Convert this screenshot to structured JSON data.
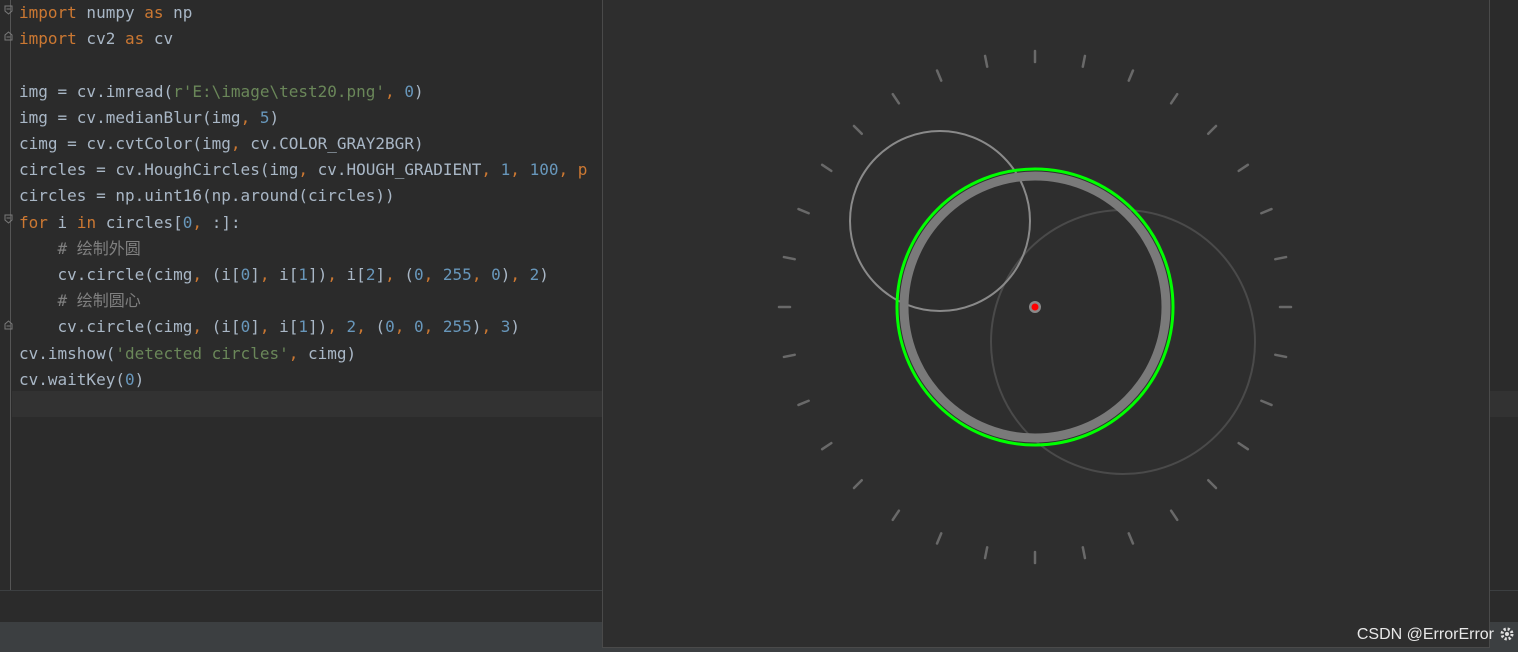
{
  "editor": {
    "lines": [
      {
        "tokens": [
          {
            "t": "import",
            "c": "kw"
          },
          {
            "t": " numpy "
          },
          {
            "t": "as",
            "c": "kw"
          },
          {
            "t": " np"
          }
        ]
      },
      {
        "tokens": [
          {
            "t": "import",
            "c": "kw"
          },
          {
            "t": " cv2 "
          },
          {
            "t": "as",
            "c": "kw"
          },
          {
            "t": " cv"
          }
        ]
      },
      {
        "tokens": []
      },
      {
        "tokens": [
          {
            "t": "img = cv.imread("
          },
          {
            "t": "r'E:\\image\\test20.png'",
            "c": "str"
          },
          {
            "t": ", ",
            "c": "kw"
          },
          {
            "t": "0",
            "c": "num"
          },
          {
            "t": ")"
          }
        ]
      },
      {
        "tokens": [
          {
            "t": "img = cv.medianBlur(img"
          },
          {
            "t": ", ",
            "c": "kw"
          },
          {
            "t": "5",
            "c": "num"
          },
          {
            "t": ")"
          }
        ]
      },
      {
        "tokens": [
          {
            "t": "cimg = cv.cvtColor(img"
          },
          {
            "t": ", ",
            "c": "kw"
          },
          {
            "t": "cv.COLOR_GRAY2BGR)"
          }
        ]
      },
      {
        "tokens": [
          {
            "t": "circles = cv.HoughCircles(img"
          },
          {
            "t": ", ",
            "c": "kw"
          },
          {
            "t": "cv.HOUGH_GRADIENT"
          },
          {
            "t": ", ",
            "c": "kw"
          },
          {
            "t": "1",
            "c": "num"
          },
          {
            "t": ", ",
            "c": "kw"
          },
          {
            "t": "100",
            "c": "num"
          },
          {
            "t": ", p",
            "c": "kw"
          }
        ]
      },
      {
        "tokens": [
          {
            "t": "circles = np.uint16(np.around(circles))"
          }
        ]
      },
      {
        "tokens": [
          {
            "t": "for",
            "c": "kw"
          },
          {
            "t": " i "
          },
          {
            "t": "in",
            "c": "kw"
          },
          {
            "t": " circles["
          },
          {
            "t": "0",
            "c": "num"
          },
          {
            "t": ", ",
            "c": "kw"
          },
          {
            "t": ":]:"
          }
        ]
      },
      {
        "tokens": [
          {
            "t": "    "
          },
          {
            "t": "# 绘制外圆",
            "c": "cmt"
          }
        ]
      },
      {
        "tokens": [
          {
            "t": "    cv.circle(cimg"
          },
          {
            "t": ", ",
            "c": "kw"
          },
          {
            "t": "(i["
          },
          {
            "t": "0",
            "c": "num"
          },
          {
            "t": "]"
          },
          {
            "t": ", ",
            "c": "kw"
          },
          {
            "t": "i["
          },
          {
            "t": "1",
            "c": "num"
          },
          {
            "t": "])"
          },
          {
            "t": ", ",
            "c": "kw"
          },
          {
            "t": "i["
          },
          {
            "t": "2",
            "c": "num"
          },
          {
            "t": "]"
          },
          {
            "t": ", ",
            "c": "kw"
          },
          {
            "t": "("
          },
          {
            "t": "0",
            "c": "num"
          },
          {
            "t": ", ",
            "c": "kw"
          },
          {
            "t": "255",
            "c": "num"
          },
          {
            "t": ", ",
            "c": "kw"
          },
          {
            "t": "0",
            "c": "num"
          },
          {
            "t": ")"
          },
          {
            "t": ", ",
            "c": "kw"
          },
          {
            "t": "2",
            "c": "num"
          },
          {
            "t": ")"
          }
        ]
      },
      {
        "tokens": [
          {
            "t": "    "
          },
          {
            "t": "# 绘制圆心",
            "c": "cmt"
          }
        ]
      },
      {
        "tokens": [
          {
            "t": "    cv.circle(cimg"
          },
          {
            "t": ", ",
            "c": "kw"
          },
          {
            "t": "(i["
          },
          {
            "t": "0",
            "c": "num"
          },
          {
            "t": "]"
          },
          {
            "t": ", ",
            "c": "kw"
          },
          {
            "t": "i["
          },
          {
            "t": "1",
            "c": "num"
          },
          {
            "t": "])"
          },
          {
            "t": ", ",
            "c": "kw"
          },
          {
            "t": "2",
            "c": "num"
          },
          {
            "t": ", ",
            "c": "kw"
          },
          {
            "t": "("
          },
          {
            "t": "0",
            "c": "num"
          },
          {
            "t": ", ",
            "c": "kw"
          },
          {
            "t": "0",
            "c": "num"
          },
          {
            "t": ", ",
            "c": "kw"
          },
          {
            "t": "255",
            "c": "num"
          },
          {
            "t": ")"
          },
          {
            "t": ", ",
            "c": "kw"
          },
          {
            "t": "3",
            "c": "num"
          },
          {
            "t": ")"
          }
        ]
      },
      {
        "tokens": [
          {
            "t": "cv.imshow("
          },
          {
            "t": "'detected circles'",
            "c": "str"
          },
          {
            "t": ", ",
            "c": "kw"
          },
          {
            "t": "cimg)"
          }
        ]
      },
      {
        "tokens": [
          {
            "t": "cv.waitKey("
          },
          {
            "t": "0",
            "c": "num"
          },
          {
            "t": ")"
          }
        ]
      }
    ]
  },
  "image_window": {
    "circle_color": "#00ff00",
    "center_color": "#ff0000"
  },
  "watermark": {
    "text": "CSDN @ErrorError",
    "icon": "gear-icon"
  },
  "colors": {
    "keyword": "#cc7832",
    "number": "#6897bb",
    "string": "#6a8759",
    "comment": "#808080",
    "text": "#a9b7c6",
    "background": "#2b2b2b"
  }
}
